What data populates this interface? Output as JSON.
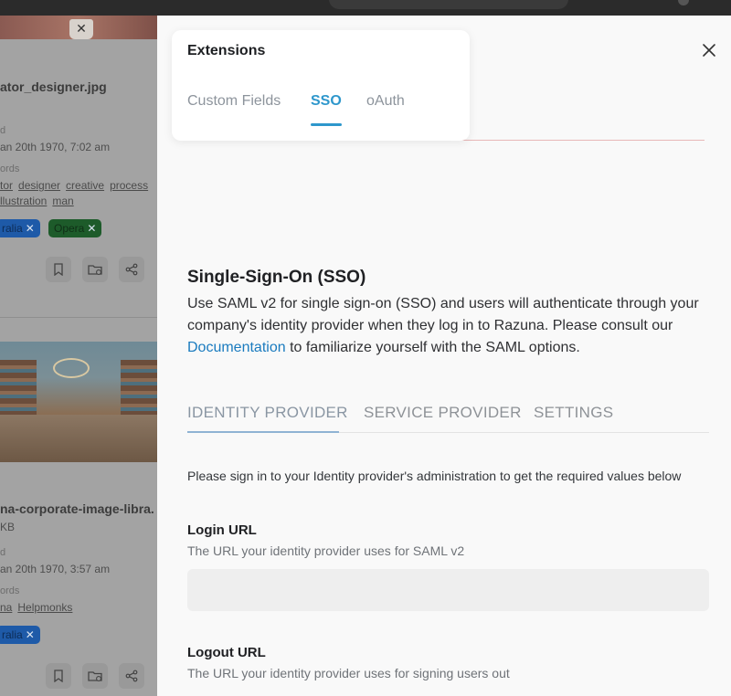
{
  "background": {
    "card1": {
      "filename": "ator_designer.jpg",
      "meta_label": "d",
      "date": "an 20th 1970, 7:02 am",
      "keywords_label": "ords",
      "keywords_row1": [
        "tor",
        "designer",
        "creative",
        "process"
      ],
      "keywords_row2": [
        "llustration",
        "man"
      ],
      "tags": [
        {
          "label": "ralia"
        },
        {
          "label": "Opera"
        }
      ]
    },
    "card2": {
      "filename": "na-corporate-image-libra.",
      "size": "KB",
      "meta_label": "d",
      "date": "an 20th 1970, 3:57 am",
      "keywords_label": "ords",
      "keywords_row1": [
        "na",
        "Helpmonks"
      ],
      "tags": [
        {
          "label": "ralia"
        }
      ]
    },
    "tag_close": "✕",
    "icons": [
      "bookmark-icon",
      "folder-add-icon",
      "share-icon"
    ]
  },
  "popup": {
    "title": "Extensions",
    "tabs": [
      {
        "label": "Custom Fields",
        "active": false
      },
      {
        "label": "SSO",
        "active": true
      },
      {
        "label": "oAuth",
        "active": false
      }
    ]
  },
  "panel": {
    "sso": {
      "title": "Single-Sign-On (SSO)",
      "desc_before": "Use SAML v2 for single sign-on (SSO) and users will authenticate through your company's identity provider when they log in to Razuna. Please consult our ",
      "desc_link": "Documentation",
      "desc_after": " to familiarize yourself with the SAML options."
    },
    "subtabs": [
      {
        "label": "IDENTITY PROVIDER",
        "active": true
      },
      {
        "label": "SERVICE PROVIDER",
        "active": false
      },
      {
        "label": "SETTINGS",
        "active": false
      }
    ],
    "instructions": "Please sign in to your Identity provider's administration to get the required values below",
    "fields": [
      {
        "label": "Login URL",
        "help": "The URL your identity provider uses for SAML v2",
        "value": ""
      },
      {
        "label": "Logout URL",
        "help": "The URL your identity provider uses for signing users out",
        "value": ""
      }
    ]
  },
  "colors": {
    "accent": "#2e97cc",
    "link": "#1a7bbf"
  }
}
